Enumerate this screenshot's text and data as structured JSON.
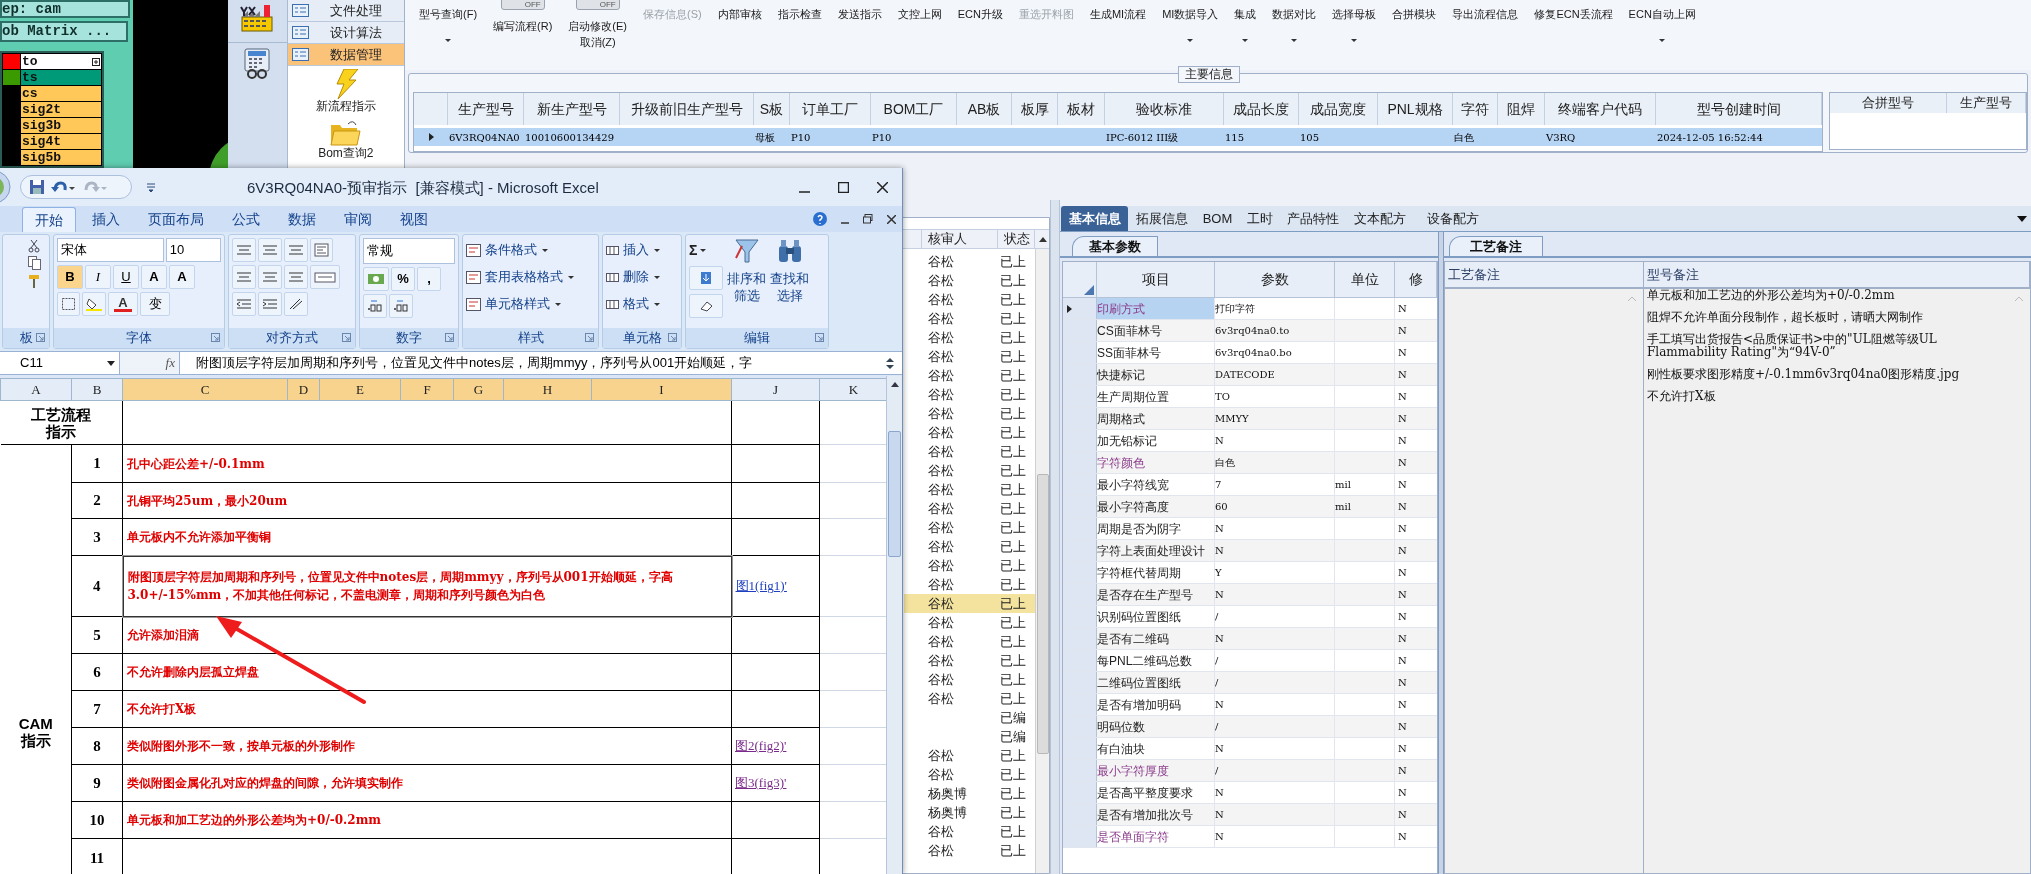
{
  "cam_panel": {
    "buttons": [
      "ep: cam",
      "ob Matrix ..."
    ],
    "layers": [
      {
        "name": "to",
        "kind": "work",
        "color": "#ff0000",
        "menu": true
      },
      {
        "name": "ts",
        "kind": "affected",
        "color": "#3a9a00",
        "menu": false
      },
      {
        "name": "cs",
        "kind": "board",
        "menu": false
      },
      {
        "name": "sig2t",
        "kind": "board",
        "menu": false
      },
      {
        "name": "sig3b",
        "kind": "board",
        "menu": false
      },
      {
        "name": "sig4t",
        "kind": "board",
        "menu": false
      },
      {
        "name": "sig5b",
        "kind": "board",
        "menu": false
      }
    ]
  },
  "nav": {
    "menu": [
      {
        "label": "文件处理",
        "selected": false
      },
      {
        "label": "设计算法",
        "selected": false
      },
      {
        "label": "数据管理",
        "selected": true
      }
    ],
    "actions": [
      {
        "label": "新流程指示",
        "kind": "lightning"
      },
      {
        "label": "Bom查询2",
        "kind": "folder"
      }
    ]
  },
  "toolbar": [
    {
      "label": "型号查询(F)",
      "dropdown": true,
      "disabled": false
    },
    {
      "label": "编写流程(R)",
      "switch": "OFF",
      "dropdown": false,
      "disabled": false
    },
    {
      "label": "启动修改(E)",
      "switch": "OFF",
      "sublabel": "取消(Z)",
      "dropdown": false,
      "disabled": false
    },
    {
      "label": "保存信息(S)",
      "dropdown": false,
      "disabled": true
    },
    {
      "label": "内部审核",
      "dropdown": false,
      "disabled": false
    },
    {
      "label": "指示检查",
      "dropdown": false,
      "disabled": false
    },
    {
      "label": "发送指示",
      "dropdown": false,
      "disabled": false
    },
    {
      "label": "文控上网",
      "dropdown": false,
      "disabled": false
    },
    {
      "label": "ECN升级",
      "dropdown": false,
      "disabled": false
    },
    {
      "label": "重选开料图",
      "dropdown": false,
      "disabled": true
    },
    {
      "label": "生成MI流程",
      "dropdown": false,
      "disabled": false
    },
    {
      "label": "MI数据导入",
      "dropdown": true,
      "disabled": false
    },
    {
      "label": "集成",
      "dropdown": true,
      "disabled": false
    },
    {
      "label": "数据对比",
      "dropdown": true,
      "disabled": false
    },
    {
      "label": "选择母板",
      "dropdown": true,
      "disabled": false
    },
    {
      "label": "合拼模块",
      "dropdown": false,
      "disabled": false
    },
    {
      "label": "导出流程信息",
      "dropdown": false,
      "disabled": false
    },
    {
      "label": "修复ECN丢流程",
      "dropdown": false,
      "disabled": false
    },
    {
      "label": "ECN自动上网",
      "dropdown": true,
      "disabled": false
    }
  ],
  "main_info": {
    "title": "主要信息",
    "columns": [
      "生产型号",
      "新生产型号",
      "升级前旧生产型号",
      "S板",
      "订单工厂",
      "BOM工厂",
      "AB板",
      "板厚",
      "板材",
      "验收标准",
      "成品长度",
      "成品宽度",
      "PNL规格",
      "字符",
      "阻焊",
      "终端客户代码",
      "型号创建时间"
    ],
    "rows": [
      {
        "selected": true,
        "cells": [
          "6V3RQ04NA0",
          "10010600134429",
          "",
          "母板",
          "P10",
          "P10",
          "",
          "",
          "",
          "IPC-6012 III级",
          "115",
          "105",
          "",
          "白色",
          "",
          "V3RQ",
          "2024-12-05 16:52:44"
        ]
      }
    ],
    "merge_columns": [
      "合拼型号",
      "生产型号"
    ]
  },
  "review_list": {
    "columns": [
      "核审人",
      "状态"
    ],
    "rows": [
      {
        "reviewer": "谷松",
        "status": "已上",
        "selected": false
      },
      {
        "reviewer": "谷松",
        "status": "已上",
        "selected": false
      },
      {
        "reviewer": "谷松",
        "status": "已上",
        "selected": false
      },
      {
        "reviewer": "谷松",
        "status": "已上",
        "selected": false
      },
      {
        "reviewer": "谷松",
        "status": "已上",
        "selected": false
      },
      {
        "reviewer": "谷松",
        "status": "已上",
        "selected": false
      },
      {
        "reviewer": "谷松",
        "status": "已上",
        "selected": false
      },
      {
        "reviewer": "谷松",
        "status": "已上",
        "selected": false
      },
      {
        "reviewer": "谷松",
        "status": "已上",
        "selected": false
      },
      {
        "reviewer": "谷松",
        "status": "已上",
        "selected": false
      },
      {
        "reviewer": "谷松",
        "status": "已上",
        "selected": false
      },
      {
        "reviewer": "谷松",
        "status": "已上",
        "selected": false
      },
      {
        "reviewer": "谷松",
        "status": "已上",
        "selected": false
      },
      {
        "reviewer": "谷松",
        "status": "已上",
        "selected": false
      },
      {
        "reviewer": "谷松",
        "status": "已上",
        "selected": false
      },
      {
        "reviewer": "谷松",
        "status": "已上",
        "selected": false
      },
      {
        "reviewer": "谷松",
        "status": "已上",
        "selected": false
      },
      {
        "reviewer": "谷松",
        "status": "已上",
        "selected": false
      },
      {
        "reviewer": "谷松",
        "status": "已上",
        "selected": true
      },
      {
        "reviewer": "谷松",
        "status": "已上",
        "selected": false
      },
      {
        "reviewer": "谷松",
        "status": "已上",
        "selected": false
      },
      {
        "reviewer": "谷松",
        "status": "已上",
        "selected": false
      },
      {
        "reviewer": "谷松",
        "status": "已上",
        "selected": false
      },
      {
        "reviewer": "谷松",
        "status": "已上",
        "selected": false
      },
      {
        "status": "已编",
        "selected": false
      },
      {
        "status": "已编",
        "selected": false
      },
      {
        "reviewer": "谷松",
        "status": "已上",
        "selected": false
      },
      {
        "reviewer": "谷松",
        "status": "已上",
        "selected": false
      },
      {
        "reviewer": "杨奥博",
        "status": "已上",
        "selected": false
      },
      {
        "reviewer": "杨奥博",
        "status": "已上",
        "selected": false
      },
      {
        "reviewer": "谷松",
        "status": "已上",
        "selected": false
      },
      {
        "reviewer": "谷松",
        "status": "已上",
        "selected": false
      }
    ]
  },
  "detail": {
    "tabs": [
      {
        "label": "基本信息",
        "selected": true
      },
      {
        "label": "拓展信息",
        "selected": false
      },
      {
        "label": "BOM",
        "selected": false
      },
      {
        "label": "工时",
        "selected": false
      },
      {
        "label": "产品特性",
        "selected": false
      },
      {
        "label": "文本配方",
        "selected": false
      },
      {
        "label": "设备配方",
        "selected": false
      }
    ],
    "subtab": "基本参数",
    "columns": [
      "项目",
      "参数",
      "单位",
      "修"
    ],
    "rows": [
      {
        "item": "印刷方式",
        "value": "打印字符",
        "modified": "N",
        "highlight": true,
        "selected": true
      },
      {
        "item": "CS面菲林号",
        "value": "6v3rq04na0.to",
        "modified": "N",
        "highlight": false,
        "selected": false
      },
      {
        "item": "SS面菲林号",
        "value": "6v3rq04na0.bo",
        "modified": "N",
        "highlight": false,
        "selected": false
      },
      {
        "item": "快捷标记",
        "value": "DATECODE",
        "modified": "N",
        "highlight": false,
        "selected": false
      },
      {
        "item": "生产周期位置",
        "value": "TO",
        "modified": "N",
        "highlight": false,
        "selected": false
      },
      {
        "item": "周期格式",
        "value": "MMYY",
        "modified": "N",
        "highlight": false,
        "selected": false
      },
      {
        "item": "加无铅标记",
        "value": "N",
        "modified": "N",
        "highlight": false,
        "selected": false
      },
      {
        "item": "字符颜色",
        "value": "白色",
        "modified": "N",
        "highlight": true,
        "selected": false
      },
      {
        "item": "最小字符线宽",
        "value": "7",
        "unit": "mil",
        "modified": "N",
        "highlight": false,
        "selected": false
      },
      {
        "item": "最小字符高度",
        "value": "60",
        "unit": "mil",
        "modified": "N",
        "highlight": false,
        "selected": false
      },
      {
        "item": "周期是否为阴字",
        "value": "N",
        "modified": "N",
        "highlight": false,
        "selected": false
      },
      {
        "item": "字符上表面处理设计",
        "value": "N",
        "modified": "N",
        "highlight": false,
        "selected": false
      },
      {
        "item": "字符框代替周期",
        "value": "Y",
        "modified": "N",
        "highlight": false,
        "selected": false
      },
      {
        "item": "是否存在生产型号",
        "value": "N",
        "modified": "N",
        "highlight": false,
        "selected": false
      },
      {
        "item": "识别码位置图纸",
        "value": "/",
        "modified": "N",
        "highlight": false,
        "selected": false
      },
      {
        "item": "是否有二维码",
        "value": "N",
        "modified": "N",
        "highlight": false,
        "selected": false
      },
      {
        "item": "每PNL二维码总数",
        "value": "/",
        "modified": "N",
        "highlight": false,
        "selected": false
      },
      {
        "item": "二维码位置图纸",
        "value": "/",
        "modified": "N",
        "highlight": false,
        "selected": false
      },
      {
        "item": "是否有增加明码",
        "value": "N",
        "modified": "N",
        "highlight": false,
        "selected": false
      },
      {
        "item": "明码位数",
        "value": "/",
        "modified": "N",
        "highlight": false,
        "selected": false
      },
      {
        "item": "有白油块",
        "value": "N",
        "modified": "N",
        "highlight": false,
        "selected": false
      },
      {
        "item": "最小字符厚度",
        "value": "/",
        "modified": "N",
        "highlight": true,
        "selected": false
      },
      {
        "item": "是否高平整度要求",
        "value": "N",
        "modified": "N",
        "highlight": false,
        "selected": false
      },
      {
        "item": "是否有增加批次号",
        "value": "N",
        "modified": "N",
        "highlight": false,
        "selected": false
      },
      {
        "item": "是否单面字符",
        "value": "N",
        "modified": "N",
        "highlight": true,
        "selected": false
      }
    ]
  },
  "remarks": {
    "subtab": "工艺备注",
    "columns": [
      "工艺备注",
      "型号备注"
    ],
    "lines": [
      "单元板和加工艺边的外形公差均为+0/-0.2mm",
      "阻焊不允许单面分段制作，超长板时，请晒大网制作",
      "手工填写出货报告<品质保证书>中的\"UL阻燃等级UL Flammability Rating\"为“94V-0”",
      "刚性板要求图形精度+/-0.1mm6v3rq04na0图形精度.jpg",
      "不允许打X板"
    ]
  },
  "excel": {
    "title": "6V3RQ04NA0-预审指示  [兼容模式] - Microsoft Excel",
    "tabs": [
      {
        "label": "开始",
        "selected": true
      },
      {
        "label": "插入",
        "selected": false
      },
      {
        "label": "页面布局",
        "selected": false
      },
      {
        "label": "公式",
        "selected": false
      },
      {
        "label": "数据",
        "selected": false
      },
      {
        "label": "审阅",
        "selected": false
      },
      {
        "label": "视图",
        "selected": false
      }
    ],
    "ribbon": {
      "groups": [
        "板",
        "字体",
        "对齐方式",
        "数字",
        "样式",
        "单元格",
        "编辑"
      ],
      "font_name": "宋体",
      "font_size": "10",
      "font_buttons": [
        "B",
        "I",
        "U",
        "A",
        "A"
      ],
      "font_color": "A",
      "phonetic": "变",
      "number_format": "常规",
      "number_buttons": [
        "%",
        ","
      ],
      "styles": [
        "条件格式",
        "套用表格格式",
        "单元格样式"
      ],
      "cells": [
        "插入",
        "删除",
        "格式"
      ],
      "sigma": "Σ",
      "editing": [
        [
          "排序和",
          "筛选"
        ],
        [
          "查找和",
          "选择"
        ]
      ]
    },
    "formula_bar": {
      "cell": "C11",
      "fx": "fx",
      "content": "附图顶层字符层加周期和序列号，位置见文件中notes层，周期mmyy，序列号从001开始顺延，字"
    },
    "columns": [
      {
        "label": "A",
        "selected": false
      },
      {
        "label": "B",
        "selected": false
      },
      {
        "label": "C",
        "selected": true
      },
      {
        "label": "D",
        "selected": true
      },
      {
        "label": "E",
        "selected": true
      },
      {
        "label": "F",
        "selected": true
      },
      {
        "label": "G",
        "selected": true
      },
      {
        "label": "H",
        "selected": true
      },
      {
        "label": "I",
        "selected": true
      },
      {
        "label": "J",
        "selected": false
      },
      {
        "label": "K",
        "selected": false
      }
    ],
    "header_label": "工艺流程指示",
    "section_label": "CAM指示",
    "rows": [
      {
        "number": "1",
        "text": "孔中心距公差+/-0.1mm",
        "selected": false
      },
      {
        "number": "2",
        "text": "孔铜平均25um，最小20um",
        "selected": false
      },
      {
        "number": "3",
        "text": "单元板内不允许添加平衡铜",
        "selected": false
      },
      {
        "number": "4",
        "text": "附图顶层字符层加周期和序列号，位置见文件中notes层，周期mmyy，序列号从001开始顺延，字高3.0+/-15%mm，不加其他任何标记，不盖电测章，周期和序列号颜色为白色",
        "link": {
          "text": "图1(fig1)'",
          "visited": false
        },
        "selected": true
      },
      {
        "number": "5",
        "text": "允许添加泪滴",
        "selected": false
      },
      {
        "number": "6",
        "text": "不允许删除内层孤立焊盘",
        "selected": false
      },
      {
        "number": "7",
        "text": "不允许打X板",
        "selected": false
      },
      {
        "number": "8",
        "text": "类似附图外形不一致，按单元板的外形制作",
        "link": {
          "text": "图2(fig2)'",
          "visited": true
        },
        "selected": false
      },
      {
        "number": "9",
        "text": "类似附图金属化孔对应的焊盘的间隙，允许填实制作",
        "link": {
          "text": "图3(fig3)'",
          "visited": true
        },
        "selected": false
      },
      {
        "number": "10",
        "text": "单元板和加工艺边的外形公差均为+0/-0.2mm",
        "selected": false
      },
      {
        "number": "11",
        "selected": false
      }
    ]
  }
}
